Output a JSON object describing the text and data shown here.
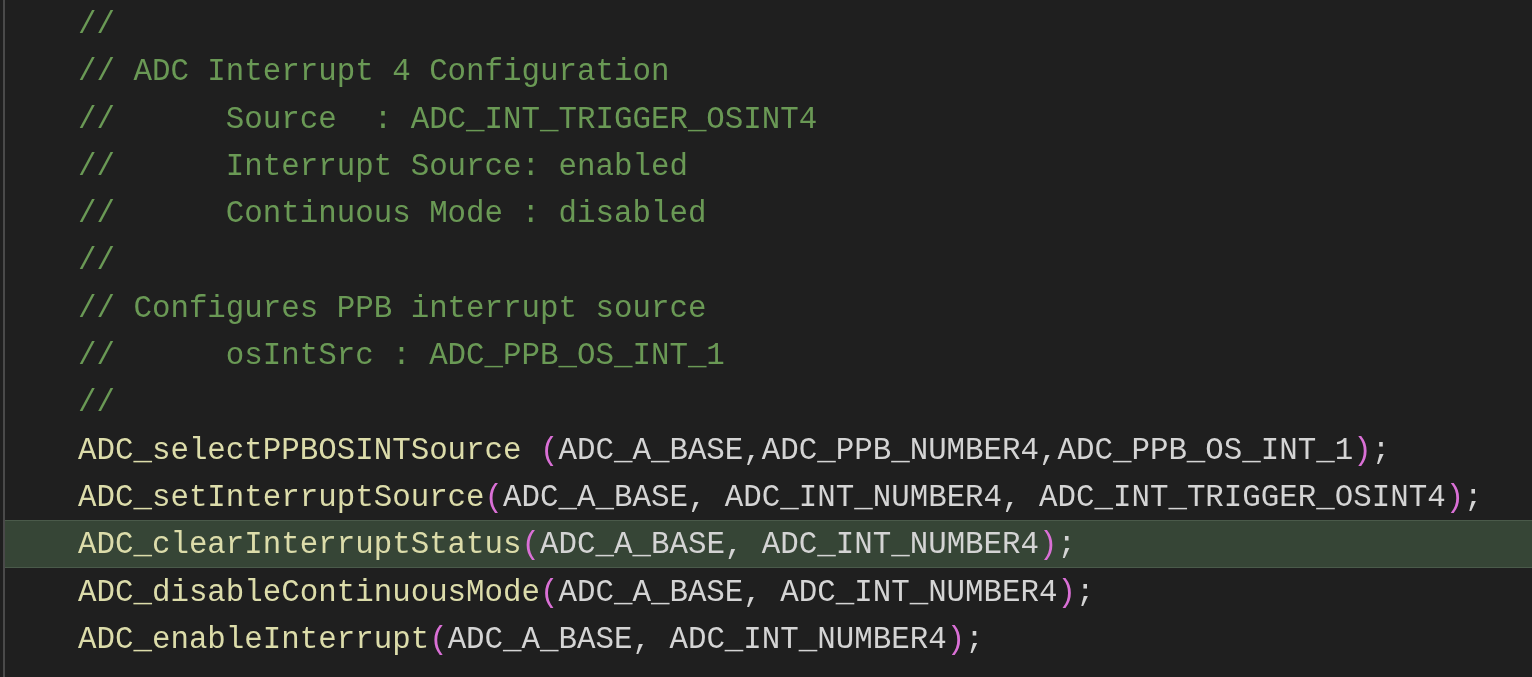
{
  "editor": {
    "lines": [
      {
        "highlighted": false,
        "tokens": [
          {
            "kind": "comment",
            "text": "//"
          }
        ]
      },
      {
        "highlighted": false,
        "tokens": [
          {
            "kind": "comment",
            "text": "// ADC Interrupt 4 Configuration"
          }
        ]
      },
      {
        "highlighted": false,
        "tokens": [
          {
            "kind": "comment",
            "text": "//      Source  : ADC_INT_TRIGGER_OSINT4"
          }
        ]
      },
      {
        "highlighted": false,
        "tokens": [
          {
            "kind": "comment",
            "text": "//      Interrupt Source: enabled"
          }
        ]
      },
      {
        "highlighted": false,
        "tokens": [
          {
            "kind": "comment",
            "text": "//      Continuous Mode : disabled"
          }
        ]
      },
      {
        "highlighted": false,
        "tokens": [
          {
            "kind": "comment",
            "text": "//"
          }
        ]
      },
      {
        "highlighted": false,
        "tokens": [
          {
            "kind": "comment",
            "text": "// Configures PPB interrupt source"
          }
        ]
      },
      {
        "highlighted": false,
        "tokens": [
          {
            "kind": "comment",
            "text": "//      osIntSrc : ADC_PPB_OS_INT_1"
          }
        ]
      },
      {
        "highlighted": false,
        "tokens": [
          {
            "kind": "comment",
            "text": "//"
          }
        ]
      },
      {
        "highlighted": false,
        "tokens": [
          {
            "kind": "function",
            "text": "ADC_selectPPBOSINTSource "
          },
          {
            "kind": "bracket",
            "text": "("
          },
          {
            "kind": "text",
            "text": "ADC_A_BASE,ADC_PPB_NUMBER4,ADC_PPB_OS_INT_1"
          },
          {
            "kind": "bracket",
            "text": ")"
          },
          {
            "kind": "text",
            "text": ";"
          }
        ]
      },
      {
        "highlighted": false,
        "tokens": [
          {
            "kind": "function",
            "text": "ADC_setInterruptSource"
          },
          {
            "kind": "bracket",
            "text": "("
          },
          {
            "kind": "text",
            "text": "ADC_A_BASE, ADC_INT_NUMBER4, ADC_INT_TRIGGER_OSINT4"
          },
          {
            "kind": "bracket",
            "text": ")"
          },
          {
            "kind": "text",
            "text": ";"
          }
        ]
      },
      {
        "highlighted": true,
        "tokens": [
          {
            "kind": "function",
            "text": "ADC_clearInterruptStatus"
          },
          {
            "kind": "bracket",
            "text": "("
          },
          {
            "kind": "text",
            "text": "ADC_A_BASE, ADC_INT_NUMBER4"
          },
          {
            "kind": "bracket",
            "text": ")"
          },
          {
            "kind": "text",
            "text": ";"
          }
        ]
      },
      {
        "highlighted": false,
        "tokens": [
          {
            "kind": "function",
            "text": "ADC_disableContinuousMode"
          },
          {
            "kind": "bracket",
            "text": "("
          },
          {
            "kind": "text",
            "text": "ADC_A_BASE, ADC_INT_NUMBER4"
          },
          {
            "kind": "bracket",
            "text": ")"
          },
          {
            "kind": "text",
            "text": ";"
          }
        ]
      },
      {
        "highlighted": false,
        "tokens": [
          {
            "kind": "function",
            "text": "ADC_enableInterrupt"
          },
          {
            "kind": "bracket",
            "text": "("
          },
          {
            "kind": "text",
            "text": "ADC_A_BASE, ADC_INT_NUMBER4"
          },
          {
            "kind": "bracket",
            "text": ")"
          },
          {
            "kind": "text",
            "text": ";"
          }
        ]
      }
    ]
  }
}
